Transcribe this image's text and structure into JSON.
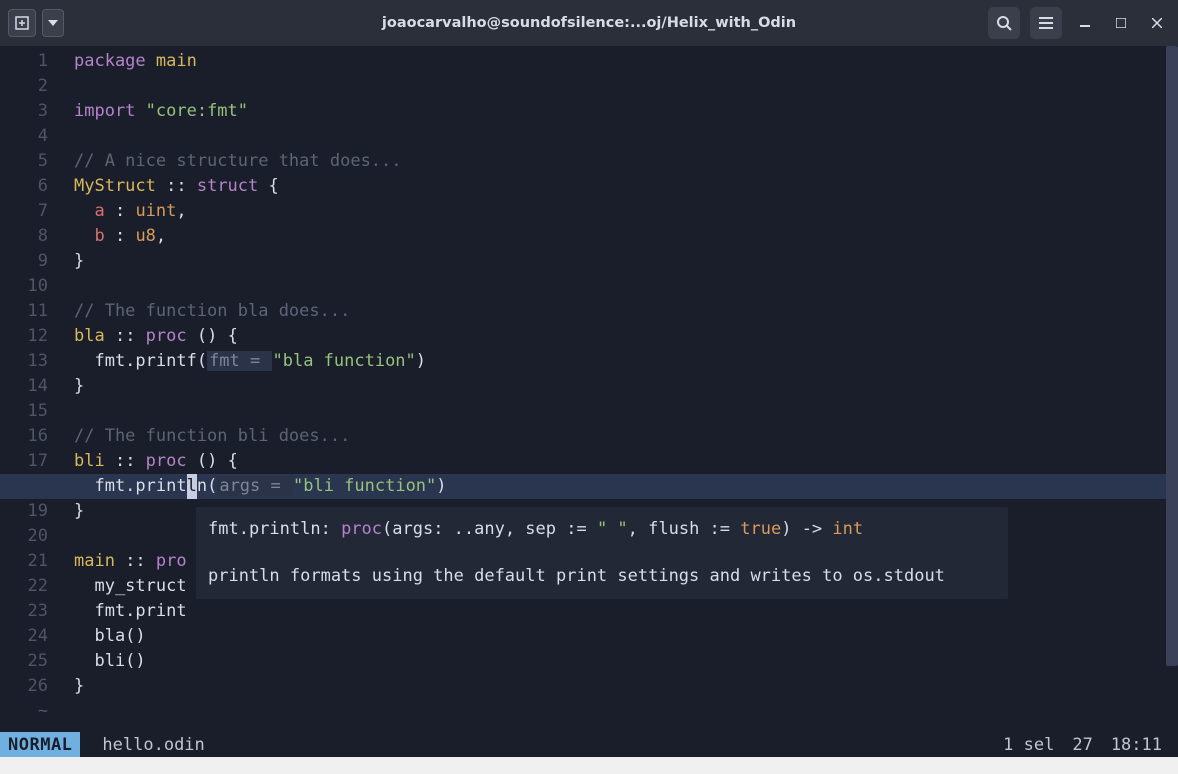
{
  "titlebar": {
    "title": "joaocarvalho@soundofsilence:...oj/Helix_with_Odin"
  },
  "code": {
    "lines": [
      {
        "n": "1",
        "content": [
          {
            "t": "package ",
            "c": "kw-pkg"
          },
          {
            "t": "main",
            "c": "ident-y"
          }
        ]
      },
      {
        "n": "2",
        "content": []
      },
      {
        "n": "3",
        "content": [
          {
            "t": "import ",
            "c": "kw-imp"
          },
          {
            "t": "\"core:fmt\"",
            "c": "str"
          }
        ]
      },
      {
        "n": "4",
        "content": []
      },
      {
        "n": "5",
        "content": [
          {
            "t": "// A nice structure that does...",
            "c": "com"
          }
        ]
      },
      {
        "n": "6",
        "content": [
          {
            "t": "MyStruct",
            "c": "ident-y"
          },
          {
            "t": " :: ",
            "c": "op"
          },
          {
            "t": "struct",
            "c": "kw-type"
          },
          {
            "t": " {",
            "c": "op"
          }
        ]
      },
      {
        "n": "7",
        "content": [
          {
            "t": "  a ",
            "c": "field"
          },
          {
            "t": ": ",
            "c": "op"
          },
          {
            "t": "uint",
            "c": "type-t"
          },
          {
            "t": ",",
            "c": "op"
          }
        ]
      },
      {
        "n": "8",
        "content": [
          {
            "t": "  b ",
            "c": "field"
          },
          {
            "t": ": ",
            "c": "op"
          },
          {
            "t": "u8",
            "c": "type-t"
          },
          {
            "t": ",",
            "c": "op"
          }
        ]
      },
      {
        "n": "9",
        "content": [
          {
            "t": "}",
            "c": "op"
          }
        ]
      },
      {
        "n": "10",
        "content": []
      },
      {
        "n": "11",
        "content": [
          {
            "t": "// The function bla does...",
            "c": "com"
          }
        ]
      },
      {
        "n": "12",
        "content": [
          {
            "t": "bla",
            "c": "ident-y"
          },
          {
            "t": " :: ",
            "c": "op"
          },
          {
            "t": "proc",
            "c": "proc-kw"
          },
          {
            "t": " () {",
            "c": "op"
          }
        ]
      },
      {
        "n": "13",
        "content": [
          {
            "t": "  fmt.printf(",
            "c": "op"
          },
          {
            "t": "fmt = ",
            "c": "hint-bg"
          },
          {
            "t": "\"bla function\"",
            "c": "str"
          },
          {
            "t": ")",
            "c": "op"
          }
        ]
      },
      {
        "n": "14",
        "content": [
          {
            "t": "}",
            "c": "op"
          }
        ]
      },
      {
        "n": "15",
        "content": []
      },
      {
        "n": "16",
        "content": [
          {
            "t": "// The function bli does...",
            "c": "com"
          }
        ]
      },
      {
        "n": "17",
        "content": [
          {
            "t": "bli",
            "c": "ident-y"
          },
          {
            "t": " :: ",
            "c": "op"
          },
          {
            "t": "proc",
            "c": "proc-kw"
          },
          {
            "t": " () {",
            "c": "op"
          }
        ]
      },
      {
        "n": "18",
        "hl": true,
        "content": [
          {
            "t": "  fmt.print",
            "c": "op"
          },
          {
            "t": "l",
            "c": "cursor-block"
          },
          {
            "t": "n(",
            "c": "op"
          },
          {
            "t": "args = ",
            "c": "hint-bg"
          },
          {
            "t": "\"bli function\"",
            "c": "str"
          },
          {
            "t": ")",
            "c": "op"
          }
        ]
      },
      {
        "n": "19",
        "content": [
          {
            "t": "}",
            "c": "op"
          }
        ]
      },
      {
        "n": "20",
        "content": []
      },
      {
        "n": "21",
        "content": [
          {
            "t": "main",
            "c": "ident-y"
          },
          {
            "t": " :: ",
            "c": "op"
          },
          {
            "t": "pro",
            "c": "proc-kw"
          }
        ]
      },
      {
        "n": "22",
        "content": [
          {
            "t": "  my_struct",
            "c": "op"
          }
        ]
      },
      {
        "n": "23",
        "content": [
          {
            "t": "  fmt.print",
            "c": "op"
          }
        ]
      },
      {
        "n": "24",
        "content": [
          {
            "t": "  bla()",
            "c": "op"
          }
        ]
      },
      {
        "n": "25",
        "content": [
          {
            "t": "  bli()",
            "c": "op"
          }
        ]
      },
      {
        "n": "26",
        "content": [
          {
            "t": "}",
            "c": "op"
          }
        ]
      }
    ],
    "tilde": "~"
  },
  "tooltip": {
    "sig_prefix": "fmt.println: ",
    "sig_kw": "proc",
    "sig_args": "(args: ..any, sep := ",
    "sig_str": "\" \"",
    "sig_mid": ", flush := ",
    "sig_bool": "true",
    "sig_close": ") -> ",
    "sig_ret": "int",
    "doc": "println formats using the default print settings and writes to os.stdout"
  },
  "statusbar": {
    "mode": "NORMAL",
    "file": "hello.odin",
    "sel": "1 sel",
    "count": "27",
    "pos": "18:11"
  }
}
